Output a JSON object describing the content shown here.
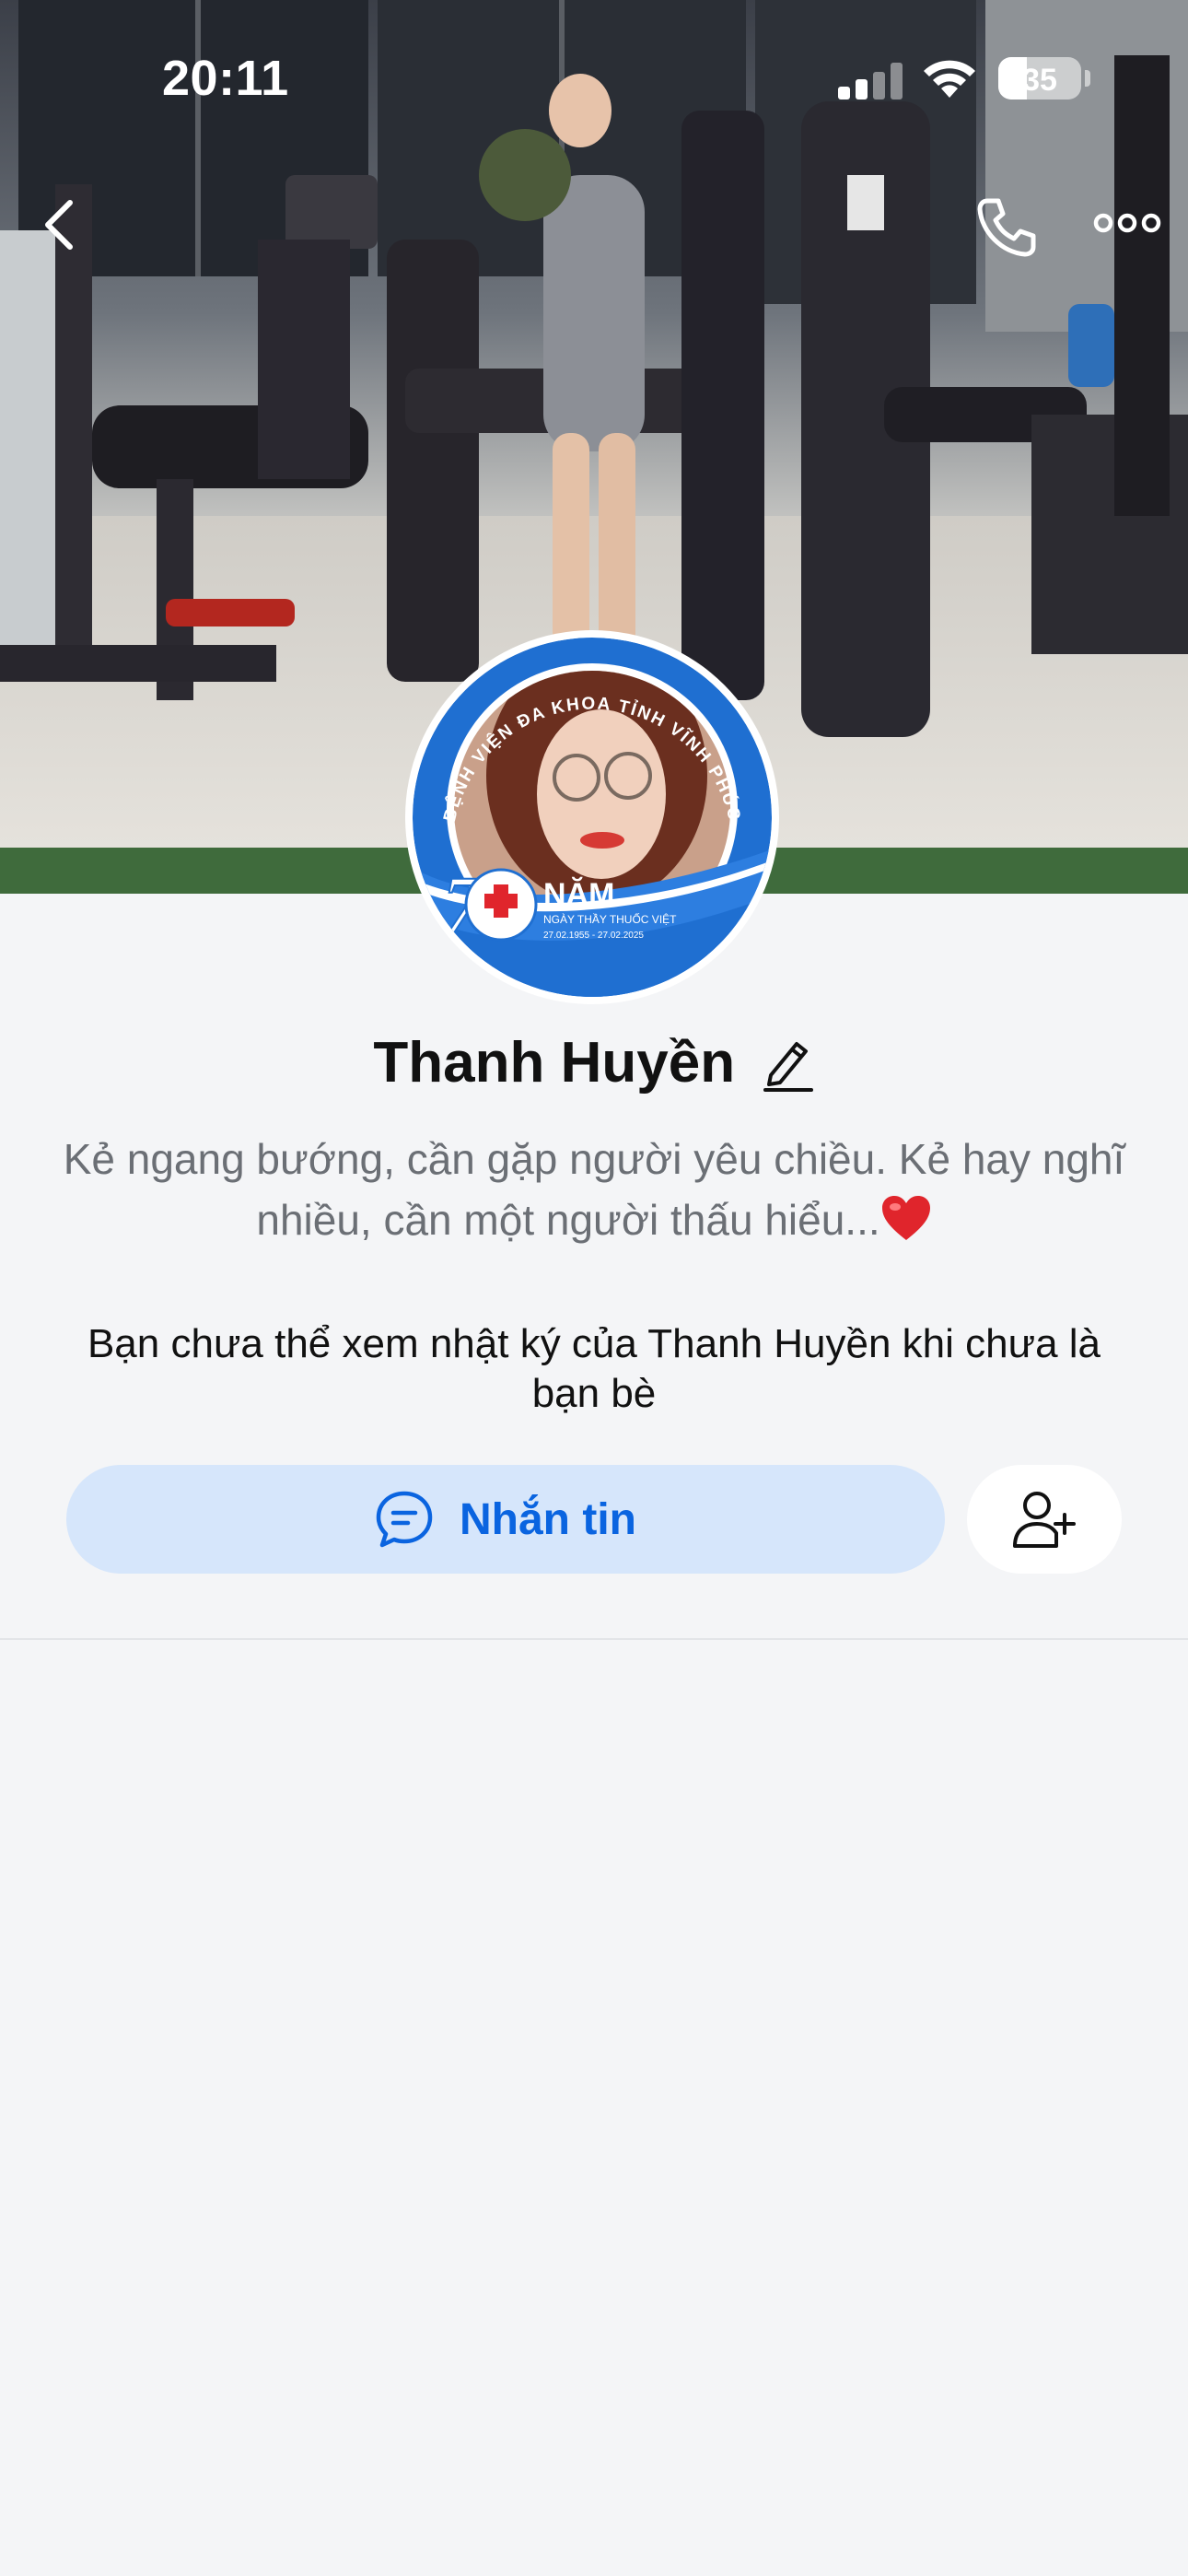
{
  "status_bar": {
    "time": "20:11",
    "battery": "35"
  },
  "nav": {
    "back_icon": "chevron-left-icon",
    "call_icon": "phone-icon",
    "more_icon": "more-horizontal-icon"
  },
  "avatar": {
    "frame_text": "BỆNH VIỆN ĐA KHOA TỈNH VĨNH PHÚC",
    "badge_number": "70",
    "badge_title": "NĂM",
    "badge_subtitle": "NGÀY THẦY THUỐC VIỆT",
    "badge_dates": "27.02.1955 - 27.02.2025"
  },
  "profile": {
    "name": "Thanh Huyền",
    "bio_line1": "Kẻ ngang bướng, cần gặp người yêu chiều. Kẻ hay nghĩ",
    "bio_line2": "nhiều, cần một người thấu hiểu...",
    "notice": "Bạn chưa thể xem nhật ký của Thanh Huyền khi chưa là bạn bè"
  },
  "actions": {
    "message_label": "Nhắn tin",
    "add_friend_icon": "add-friend-icon"
  },
  "colors": {
    "accent": "#0A64E0",
    "message_button_bg": "#D6E6FB",
    "page_bg": "#F4F5F7",
    "avatar_frame_blue": "#1F6FD1",
    "heart": "#E0252C"
  }
}
